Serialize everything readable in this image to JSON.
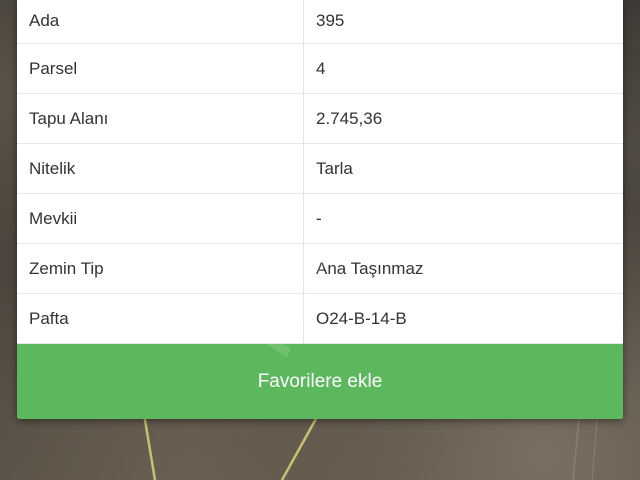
{
  "parcel_info": {
    "rows": [
      {
        "label": "Ada",
        "value": "395"
      },
      {
        "label": "Parsel",
        "value": "4"
      },
      {
        "label": "Tapu Alanı",
        "value": "2.745,36"
      },
      {
        "label": "Nitelik",
        "value": "Tarla"
      },
      {
        "label": "Mevkii",
        "value": "-"
      },
      {
        "label": "Zemin Tip",
        "value": "Ana Taşınmaz"
      },
      {
        "label": "Pafta",
        "value": "O24-B-14-B"
      }
    ]
  },
  "actions": {
    "favorite_label": "Favorilere ekle"
  },
  "colors": {
    "button_green": "#5cb85c",
    "panel_white": "#ffffff",
    "border_gray": "#e6e6e6"
  }
}
